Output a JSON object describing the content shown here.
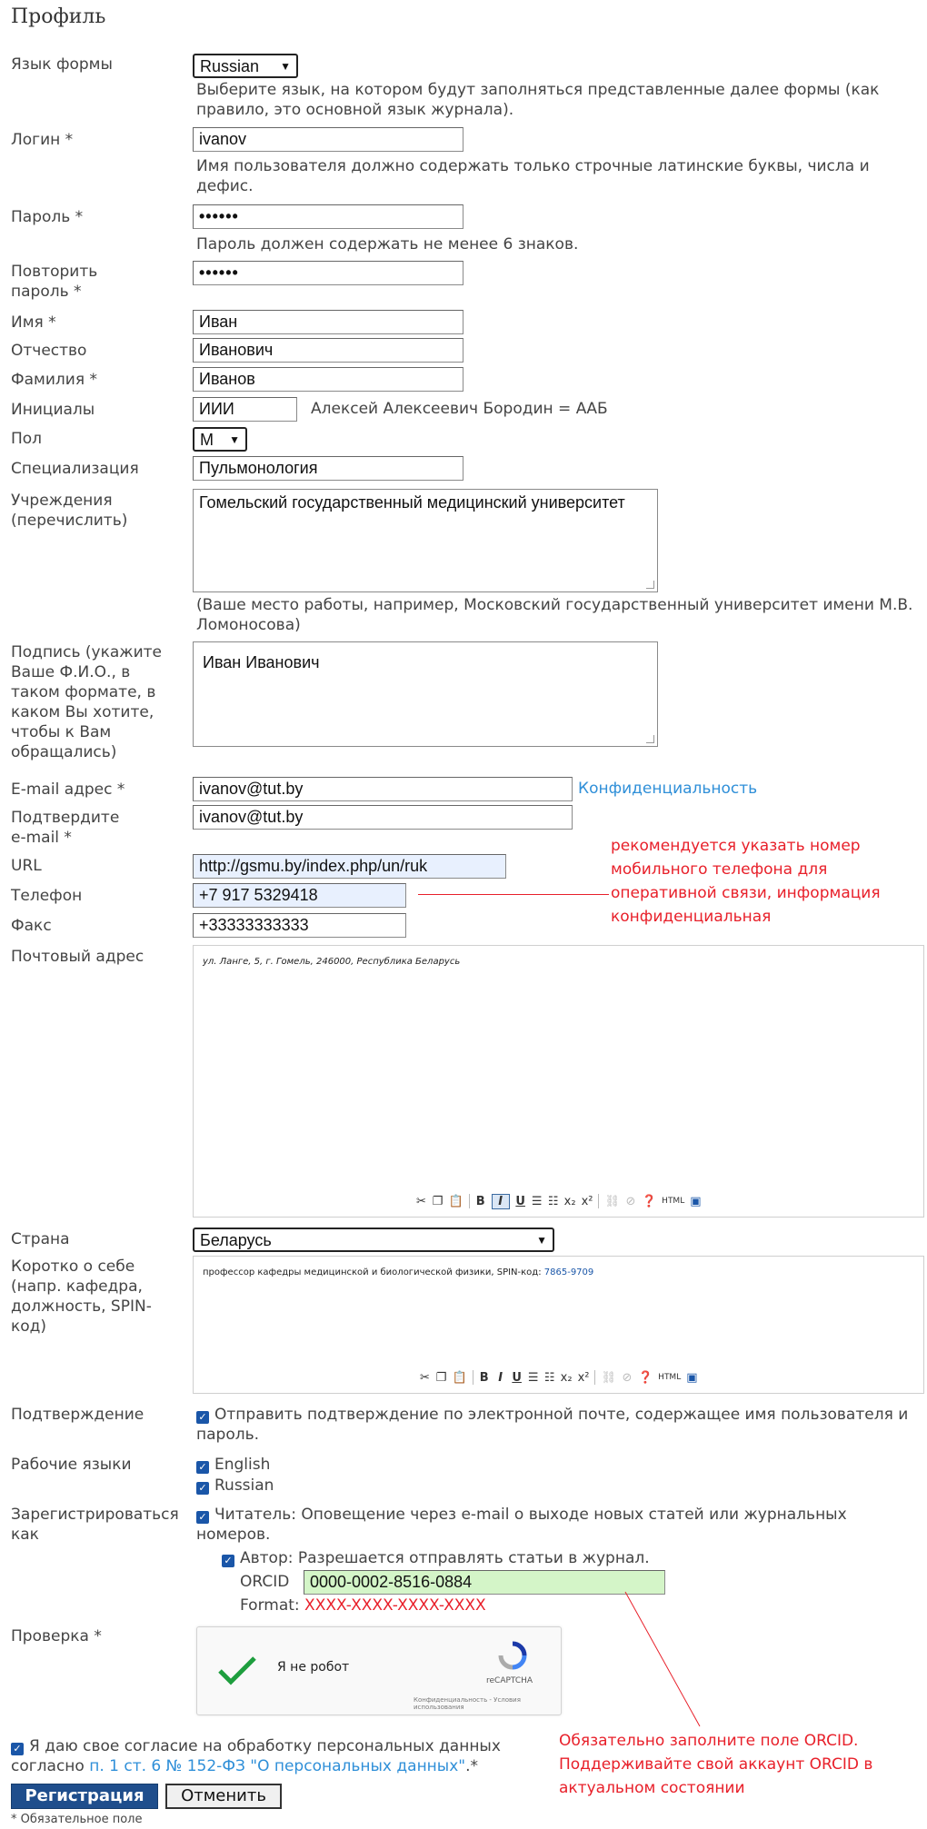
{
  "page": {
    "title": "Профиль"
  },
  "fields": {
    "language": {
      "label": "Язык формы",
      "value": "Russian",
      "hint": "Выберите язык, на котором будут заполняться представленные далее формы (как правило, это основной язык журнала)."
    },
    "login": {
      "label": "Логин *",
      "value": "ivanov",
      "hint": "Имя пользователя должно содержать только строчные латинские буквы, числа и дефис."
    },
    "password": {
      "label": "Пароль *",
      "value": "••••••",
      "hint": "Пароль должен содержать не менее 6 знаков."
    },
    "password_repeat": {
      "label": "Повторить пароль *",
      "value": "••••••"
    },
    "first_name": {
      "label": "Имя *",
      "value": "Иван"
    },
    "middle_name": {
      "label": "Отчество",
      "value": "Иванович"
    },
    "last_name": {
      "label": "Фамилия *",
      "value": "Иванов"
    },
    "initials": {
      "label": "Инициалы",
      "value": "ИИИ",
      "hint": "Алексей Алексеевич Бородин = ААБ"
    },
    "gender": {
      "label": "Пол",
      "value": "М"
    },
    "specialization": {
      "label": "Специализация",
      "value": "Пульмонология"
    },
    "affiliation": {
      "label": "Учреждения (перечислить)",
      "value": "Гомельский государственный медицинский университет",
      "hint": "(Ваше место работы, например, Московский государственный университет имени М.В. Ломоносова)"
    },
    "signature": {
      "label": "Подпись (укажите Ваше Ф.И.О., в таком формате, в каком Вы хотите, чтобы к Вам обращались)",
      "value": "Иван Иванович"
    },
    "email": {
      "label": "E-mail адрес *",
      "value": "ivanov@tut.by",
      "privacy_link": "Конфиденциальность"
    },
    "email_confirm": {
      "label": "Подтвердите e-mail *",
      "value": "ivanov@tut.by"
    },
    "url": {
      "label": "URL",
      "value": "http://gsmu.by/index.php/un/ruk"
    },
    "phone": {
      "label": "Телефон",
      "value": "+7 917 5329418"
    },
    "fax": {
      "label": "Факс",
      "value": "+33333333333"
    },
    "mailing_address": {
      "label": "Почтовый адрес",
      "value": "ул. Ланге, 5, г. Гомель, 246000, Республика Беларусь"
    },
    "country": {
      "label": "Страна",
      "value": "Беларусь"
    },
    "bio": {
      "label": "Коротко о себе (напр. кафедра, должность, SPIN-код)",
      "value_prefix": "профессор кафедры медицинской и биологической физики, SPIN-код:",
      "value_code": "7865-9709"
    },
    "confirmation": {
      "label": "Подтверждение",
      "option": "Отправить подтверждение по электронной почте, содержащее имя пользователя и пароль."
    },
    "working_languages": {
      "label": "Рабочие языки",
      "options": [
        "English",
        "Russian"
      ]
    },
    "register_as": {
      "label": "Зарегистрироваться как",
      "reader": "Читатель: Оповещение через e-mail о выходе новых статей или журнальных номеров.",
      "author": "Автор: Разрешается отправлять статьи в журнал.",
      "orcid_label": "ORCID",
      "orcid_value": "0000-0002-8516-0884",
      "format_label": "Format:",
      "format_value": "XXXX-XXXX-XXXX-XXXX"
    },
    "verification": {
      "label": "Проверка *",
      "captcha_text": "Я не робот",
      "captcha_brand": "reCAPTCHA",
      "captcha_footer": "Конфиденциальность - Условия использования"
    }
  },
  "consent": {
    "text": "Я даю свое согласие на обработку персональных данных согласно",
    "link": "п. 1 ст. 6 № 152-ФЗ \"О персональных данных\"",
    "suffix": ".*"
  },
  "buttons": {
    "register": "Регистрация",
    "cancel": "Отменить"
  },
  "footnote": "* Обязательное поле",
  "annotations": {
    "phone_note": "рекомендуется указать номер мобильного телефона для оперативной связи, информация конфиденциальная",
    "orcid_note": "Обязательно заполните поле ORCID. Поддерживайте свой аккаунт ORCID в актуальном состоянии"
  },
  "editor_toolbar": [
    "cut-icon",
    "copy-icon",
    "paste-icon",
    "bold-icon",
    "italic-icon",
    "underline-icon",
    "bullet-list-icon",
    "numbered-list-icon",
    "subscript-icon",
    "superscript-icon",
    "link-icon",
    "unlink-icon",
    "help-icon",
    "html-icon",
    "fullscreen-icon"
  ],
  "colors": {
    "accent": "#1f4e8c",
    "link": "#2f8fd8",
    "annotation": "#e8202a",
    "checkbox": "#1a56a8"
  }
}
